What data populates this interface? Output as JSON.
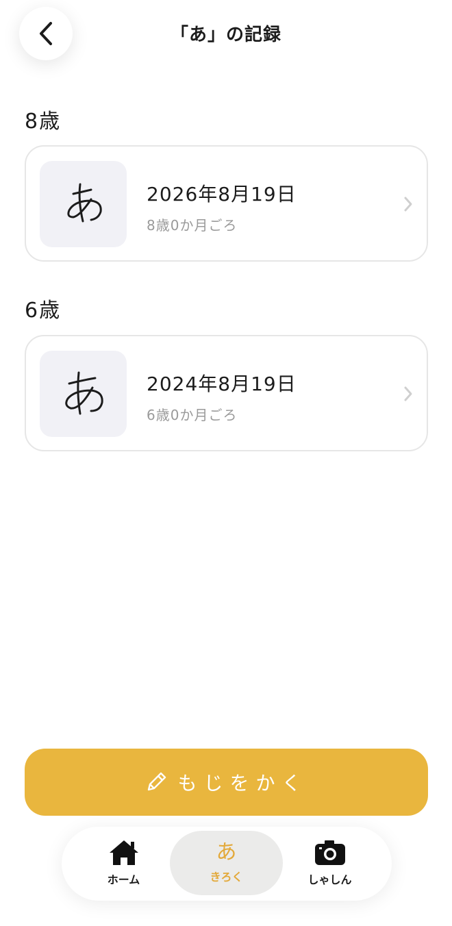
{
  "header": {
    "title": "「あ」の記録"
  },
  "sections": [
    {
      "age_heading": "8歳",
      "record": {
        "character": "あ",
        "date": "2026年8月19日",
        "age_label": "8歳0か月ごろ"
      }
    },
    {
      "age_heading": "6歳",
      "record": {
        "character": "あ",
        "date": "2024年8月19日",
        "age_label": "6歳0か月ごろ"
      }
    }
  ],
  "write_button": {
    "label": "もじをかく",
    "icon": "pencil-icon"
  },
  "tabbar": {
    "tabs": [
      {
        "label": "ホーム",
        "icon": "home-icon",
        "active": false
      },
      {
        "label": "きろく",
        "icon": "あ",
        "active": true
      },
      {
        "label": "しゃしん",
        "icon": "camera-icon",
        "active": false
      }
    ]
  },
  "colors": {
    "accent": "#e9b63e",
    "thumb_bg": "#f1f1f6",
    "card_border": "#e6e6e6"
  }
}
